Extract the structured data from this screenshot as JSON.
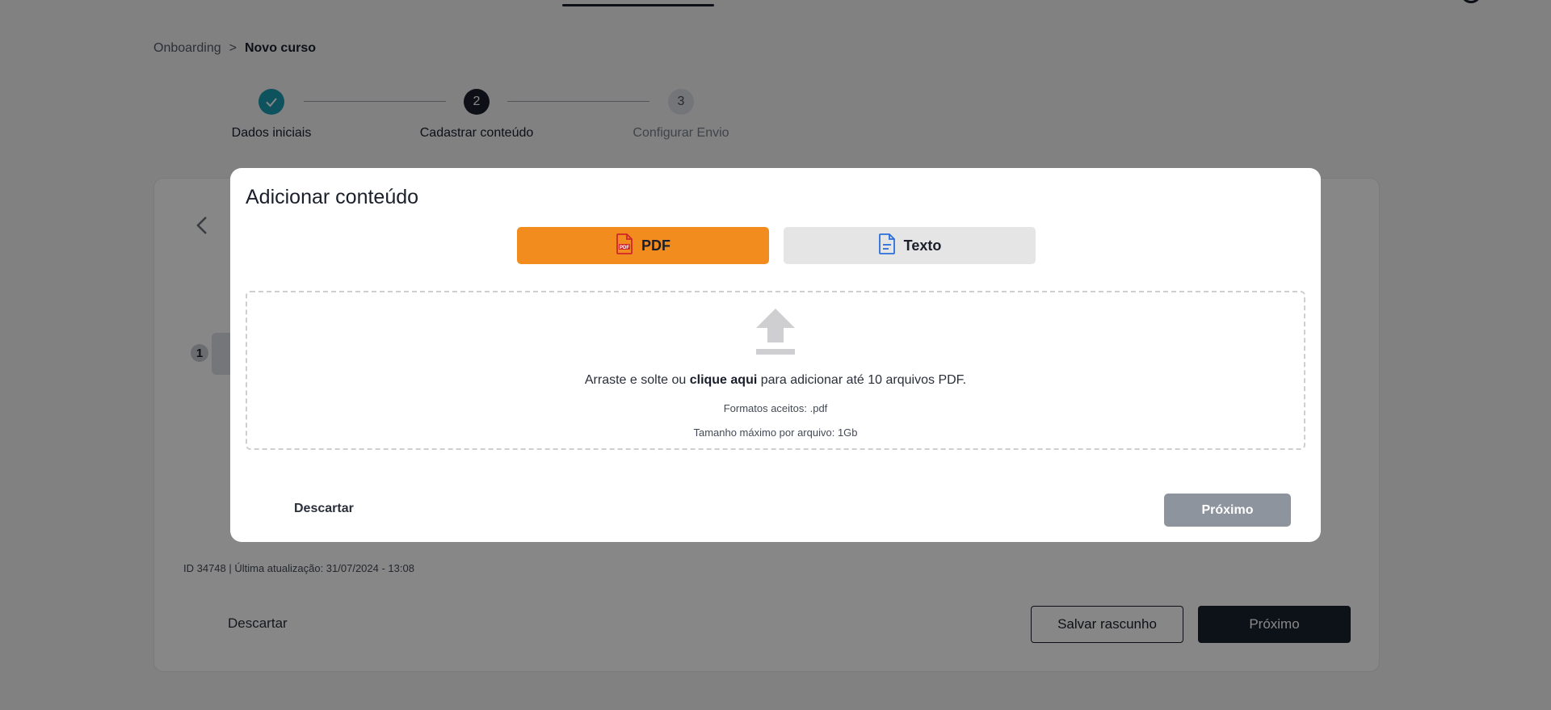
{
  "breadcrumb": {
    "parent": "Onboarding",
    "separator": ">",
    "current": "Novo curso"
  },
  "stepper": {
    "steps": [
      {
        "number": "1",
        "label": "Dados iniciais",
        "state": "done"
      },
      {
        "number": "2",
        "label": "Cadastrar conteúdo",
        "state": "active"
      },
      {
        "number": "3",
        "label": "Configurar Envio",
        "state": "todo"
      }
    ]
  },
  "content": {
    "item_number": "1",
    "meta": "ID 34748 | Última atualização: 31/07/2024 - 13:08"
  },
  "footer": {
    "discard_label": "Descartar",
    "save_draft_label": "Salvar rascunho",
    "next_label": "Próximo"
  },
  "modal": {
    "title": "Adicionar conteúdo",
    "tabs": [
      {
        "label": "PDF",
        "icon": "pdf-file-icon",
        "selected": true
      },
      {
        "label": "Texto",
        "icon": "text-file-icon",
        "selected": false
      }
    ],
    "dropzone": {
      "text_before": "Arraste e solte ou ",
      "link_text": "clique aqui",
      "text_after": " para adicionar até 10 arquivos PDF.",
      "formats": "Formatos aceitos: .pdf",
      "max_size": "Tamanho máximo por arquivo: 1Gb",
      "icon": "upload-icon"
    },
    "discard_label": "Descartar",
    "next_label": "Próximo"
  },
  "colors": {
    "accent": "#f28c1e",
    "step_done": "#1a9bb0",
    "primary_dark": "#1a2230",
    "disabled": "#8e949e",
    "text_icon_blue": "#2a6fdb",
    "pdf_icon_red": "#d0262b"
  }
}
